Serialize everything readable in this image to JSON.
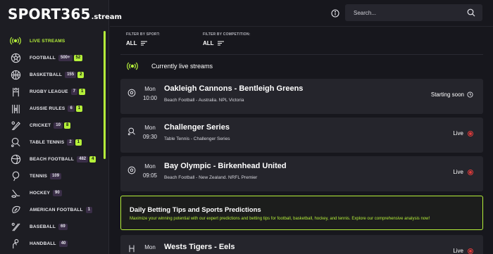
{
  "brand": {
    "name": "SPORT365",
    "suffix": ".stream"
  },
  "search": {
    "placeholder": "Search..."
  },
  "filters": {
    "sport": {
      "label": "FILTER BY SPORT:",
      "value": "ALL"
    },
    "competition": {
      "label": "FILTER BY COMPETITION:",
      "value": "ALL"
    }
  },
  "sidebar": {
    "items": [
      {
        "label": "LIVE STREAMS",
        "icon": "live-signal-icon"
      },
      {
        "label": "FOOTBALL",
        "icon": "football-icon",
        "count": "500+",
        "live": "52"
      },
      {
        "label": "BASKETBALL",
        "icon": "basketball-icon",
        "count": "155",
        "live": "2"
      },
      {
        "label": "RUGBY LEAGUE",
        "icon": "rugby-icon",
        "count": "7",
        "live": "1"
      },
      {
        "label": "AUSSIE RULES",
        "icon": "aussie-rules-icon",
        "count": "6",
        "live": "1"
      },
      {
        "label": "CRICKET",
        "icon": "cricket-icon",
        "count": "10",
        "live": "8"
      },
      {
        "label": "TABLE TENNIS",
        "icon": "table-tennis-icon",
        "count": "2",
        "live": "1"
      },
      {
        "label": "BEACH FOOTBALL",
        "icon": "beach-football-icon",
        "count": "482",
        "live": "4"
      },
      {
        "label": "TENNIS",
        "icon": "tennis-icon",
        "count": "109"
      },
      {
        "label": "HOCKEY",
        "icon": "hockey-icon",
        "count": "90"
      },
      {
        "label": "AMERICAN FOOTBALL",
        "icon": "american-football-icon",
        "count": "1"
      },
      {
        "label": "BASEBALL",
        "icon": "baseball-icon",
        "count": "69"
      },
      {
        "label": "HANDBALL",
        "icon": "handball-icon",
        "count": "40"
      }
    ]
  },
  "live_section": {
    "title": "Currently live streams"
  },
  "events": [
    {
      "day": "Mon",
      "time": "10:00",
      "name": "Oakleigh Cannons - Bentleigh Greens",
      "league": "Beach Football - Australia. NPL Victoria",
      "status": "Starting soon",
      "icon": "soccer-ball-icon"
    },
    {
      "day": "Mon",
      "time": "09:30",
      "name": "Challenger Series",
      "league": "Table Tennis - Challenger Series",
      "status": "Live",
      "icon": "table-tennis-icon"
    },
    {
      "day": "Mon",
      "time": "09:05",
      "name": "Bay Olympic - Birkenhead United",
      "league": "Beach Football - New Zealand. NRFL Premier",
      "status": "Live",
      "icon": "soccer-ball-icon"
    },
    {
      "day": "Mon",
      "time": "",
      "name": "Wests Tigers - Eels",
      "league": "",
      "status": "Live",
      "icon": "rugby-icon"
    }
  ],
  "promo": {
    "title": "Daily Betting Tips and Sports Predictions",
    "text": "Maximize your winning potential with our expert predictions and betting tips for football, basketball, hockey, and tennis. Explore our comprehensive analysis now!"
  },
  "colors": {
    "accent": "#b5f03a",
    "live": "#e23b3b",
    "background": "#17171d",
    "card": "#25252c"
  }
}
